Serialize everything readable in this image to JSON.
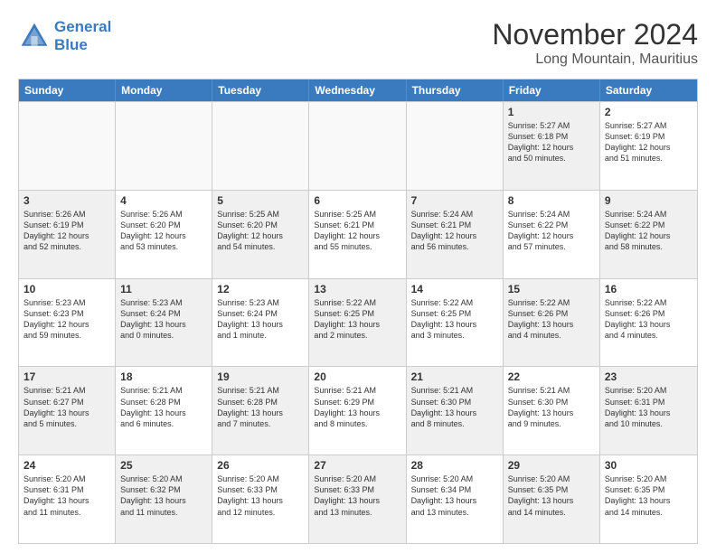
{
  "logo": {
    "line1": "General",
    "line2": "Blue"
  },
  "title": "November 2024",
  "location": "Long Mountain, Mauritius",
  "header_days": [
    "Sunday",
    "Monday",
    "Tuesday",
    "Wednesday",
    "Thursday",
    "Friday",
    "Saturday"
  ],
  "rows": [
    [
      {
        "day": "",
        "text": "",
        "empty": true
      },
      {
        "day": "",
        "text": "",
        "empty": true
      },
      {
        "day": "",
        "text": "",
        "empty": true
      },
      {
        "day": "",
        "text": "",
        "empty": true
      },
      {
        "day": "",
        "text": "",
        "empty": true
      },
      {
        "day": "1",
        "text": "Sunrise: 5:27 AM\nSunset: 6:18 PM\nDaylight: 12 hours\nand 50 minutes.",
        "shaded": true
      },
      {
        "day": "2",
        "text": "Sunrise: 5:27 AM\nSunset: 6:19 PM\nDaylight: 12 hours\nand 51 minutes.",
        "shaded": false
      }
    ],
    [
      {
        "day": "3",
        "text": "Sunrise: 5:26 AM\nSunset: 6:19 PM\nDaylight: 12 hours\nand 52 minutes.",
        "shaded": true
      },
      {
        "day": "4",
        "text": "Sunrise: 5:26 AM\nSunset: 6:20 PM\nDaylight: 12 hours\nand 53 minutes.",
        "shaded": false
      },
      {
        "day": "5",
        "text": "Sunrise: 5:25 AM\nSunset: 6:20 PM\nDaylight: 12 hours\nand 54 minutes.",
        "shaded": true
      },
      {
        "day": "6",
        "text": "Sunrise: 5:25 AM\nSunset: 6:21 PM\nDaylight: 12 hours\nand 55 minutes.",
        "shaded": false
      },
      {
        "day": "7",
        "text": "Sunrise: 5:24 AM\nSunset: 6:21 PM\nDaylight: 12 hours\nand 56 minutes.",
        "shaded": true
      },
      {
        "day": "8",
        "text": "Sunrise: 5:24 AM\nSunset: 6:22 PM\nDaylight: 12 hours\nand 57 minutes.",
        "shaded": false
      },
      {
        "day": "9",
        "text": "Sunrise: 5:24 AM\nSunset: 6:22 PM\nDaylight: 12 hours\nand 58 minutes.",
        "shaded": true
      }
    ],
    [
      {
        "day": "10",
        "text": "Sunrise: 5:23 AM\nSunset: 6:23 PM\nDaylight: 12 hours\nand 59 minutes.",
        "shaded": false
      },
      {
        "day": "11",
        "text": "Sunrise: 5:23 AM\nSunset: 6:24 PM\nDaylight: 13 hours\nand 0 minutes.",
        "shaded": true
      },
      {
        "day": "12",
        "text": "Sunrise: 5:23 AM\nSunset: 6:24 PM\nDaylight: 13 hours\nand 1 minute.",
        "shaded": false
      },
      {
        "day": "13",
        "text": "Sunrise: 5:22 AM\nSunset: 6:25 PM\nDaylight: 13 hours\nand 2 minutes.",
        "shaded": true
      },
      {
        "day": "14",
        "text": "Sunrise: 5:22 AM\nSunset: 6:25 PM\nDaylight: 13 hours\nand 3 minutes.",
        "shaded": false
      },
      {
        "day": "15",
        "text": "Sunrise: 5:22 AM\nSunset: 6:26 PM\nDaylight: 13 hours\nand 4 minutes.",
        "shaded": true
      },
      {
        "day": "16",
        "text": "Sunrise: 5:22 AM\nSunset: 6:26 PM\nDaylight: 13 hours\nand 4 minutes.",
        "shaded": false
      }
    ],
    [
      {
        "day": "17",
        "text": "Sunrise: 5:21 AM\nSunset: 6:27 PM\nDaylight: 13 hours\nand 5 minutes.",
        "shaded": true
      },
      {
        "day": "18",
        "text": "Sunrise: 5:21 AM\nSunset: 6:28 PM\nDaylight: 13 hours\nand 6 minutes.",
        "shaded": false
      },
      {
        "day": "19",
        "text": "Sunrise: 5:21 AM\nSunset: 6:28 PM\nDaylight: 13 hours\nand 7 minutes.",
        "shaded": true
      },
      {
        "day": "20",
        "text": "Sunrise: 5:21 AM\nSunset: 6:29 PM\nDaylight: 13 hours\nand 8 minutes.",
        "shaded": false
      },
      {
        "day": "21",
        "text": "Sunrise: 5:21 AM\nSunset: 6:30 PM\nDaylight: 13 hours\nand 8 minutes.",
        "shaded": true
      },
      {
        "day": "22",
        "text": "Sunrise: 5:21 AM\nSunset: 6:30 PM\nDaylight: 13 hours\nand 9 minutes.",
        "shaded": false
      },
      {
        "day": "23",
        "text": "Sunrise: 5:20 AM\nSunset: 6:31 PM\nDaylight: 13 hours\nand 10 minutes.",
        "shaded": true
      }
    ],
    [
      {
        "day": "24",
        "text": "Sunrise: 5:20 AM\nSunset: 6:31 PM\nDaylight: 13 hours\nand 11 minutes.",
        "shaded": false
      },
      {
        "day": "25",
        "text": "Sunrise: 5:20 AM\nSunset: 6:32 PM\nDaylight: 13 hours\nand 11 minutes.",
        "shaded": true
      },
      {
        "day": "26",
        "text": "Sunrise: 5:20 AM\nSunset: 6:33 PM\nDaylight: 13 hours\nand 12 minutes.",
        "shaded": false
      },
      {
        "day": "27",
        "text": "Sunrise: 5:20 AM\nSunset: 6:33 PM\nDaylight: 13 hours\nand 13 minutes.",
        "shaded": true
      },
      {
        "day": "28",
        "text": "Sunrise: 5:20 AM\nSunset: 6:34 PM\nDaylight: 13 hours\nand 13 minutes.",
        "shaded": false
      },
      {
        "day": "29",
        "text": "Sunrise: 5:20 AM\nSunset: 6:35 PM\nDaylight: 13 hours\nand 14 minutes.",
        "shaded": true
      },
      {
        "day": "30",
        "text": "Sunrise: 5:20 AM\nSunset: 6:35 PM\nDaylight: 13 hours\nand 14 minutes.",
        "shaded": false
      }
    ]
  ]
}
